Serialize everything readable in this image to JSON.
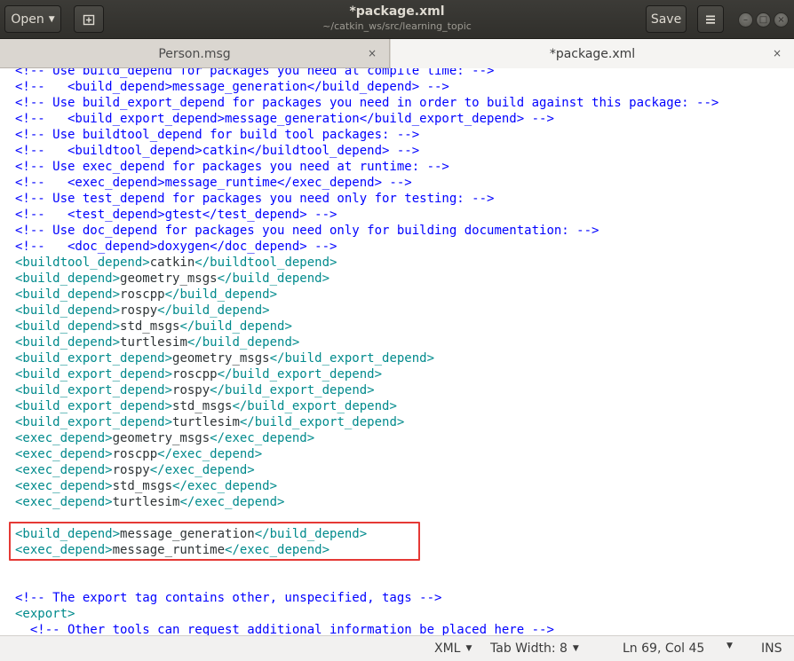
{
  "header": {
    "open_label": "Open",
    "title": "*package.xml",
    "subtitle": "~/catkin_ws/src/learning_topic",
    "save_label": "Save"
  },
  "tabs": [
    {
      "label": "Person.msg",
      "close": "×"
    },
    {
      "label": "*package.xml",
      "close": "×"
    }
  ],
  "editor": {
    "lines": [
      [
        {
          "t": "<!-- Use build_depend for packages you need at compile time: -->",
          "c": "comment"
        }
      ],
      [
        {
          "t": "<!--   <build_depend>message_generation</build_depend> -->",
          "c": "comment"
        }
      ],
      [
        {
          "t": "<!-- Use build_export_depend for packages you need in order to build against this package: -->",
          "c": "comment"
        }
      ],
      [
        {
          "t": "<!--   <build_export_depend>message_generation</build_export_depend> -->",
          "c": "comment"
        }
      ],
      [
        {
          "t": "<!-- Use buildtool_depend for build tool packages: -->",
          "c": "comment"
        }
      ],
      [
        {
          "t": "<!--   <buildtool_depend>catkin</buildtool_depend> -->",
          "c": "comment"
        }
      ],
      [
        {
          "t": "<!-- Use exec_depend for packages you need at runtime: -->",
          "c": "comment"
        }
      ],
      [
        {
          "t": "<!--   <exec_depend>message_runtime</exec_depend> -->",
          "c": "comment"
        }
      ],
      [
        {
          "t": "<!-- Use test_depend for packages you need only for testing: -->",
          "c": "comment"
        }
      ],
      [
        {
          "t": "<!--   <test_depend>gtest</test_depend> -->",
          "c": "comment"
        }
      ],
      [
        {
          "t": "<!-- Use doc_depend for packages you need only for building documentation: -->",
          "c": "comment"
        }
      ],
      [
        {
          "t": "<!--   <doc_depend>doxygen</doc_depend> -->",
          "c": "comment"
        }
      ],
      [
        {
          "t": "<buildtool_depend>",
          "c": "tag"
        },
        {
          "t": "catkin",
          "c": "text"
        },
        {
          "t": "</buildtool_depend>",
          "c": "tag"
        }
      ],
      [
        {
          "t": "<build_depend>",
          "c": "tag"
        },
        {
          "t": "geometry_msgs",
          "c": "text"
        },
        {
          "t": "</build_depend>",
          "c": "tag"
        }
      ],
      [
        {
          "t": "<build_depend>",
          "c": "tag"
        },
        {
          "t": "roscpp",
          "c": "text"
        },
        {
          "t": "</build_depend>",
          "c": "tag"
        }
      ],
      [
        {
          "t": "<build_depend>",
          "c": "tag"
        },
        {
          "t": "rospy",
          "c": "text"
        },
        {
          "t": "</build_depend>",
          "c": "tag"
        }
      ],
      [
        {
          "t": "<build_depend>",
          "c": "tag"
        },
        {
          "t": "std_msgs",
          "c": "text"
        },
        {
          "t": "</build_depend>",
          "c": "tag"
        }
      ],
      [
        {
          "t": "<build_depend>",
          "c": "tag"
        },
        {
          "t": "turtlesim",
          "c": "text"
        },
        {
          "t": "</build_depend>",
          "c": "tag"
        }
      ],
      [
        {
          "t": "<build_export_depend>",
          "c": "tag"
        },
        {
          "t": "geometry_msgs",
          "c": "text"
        },
        {
          "t": "</build_export_depend>",
          "c": "tag"
        }
      ],
      [
        {
          "t": "<build_export_depend>",
          "c": "tag"
        },
        {
          "t": "roscpp",
          "c": "text"
        },
        {
          "t": "</build_export_depend>",
          "c": "tag"
        }
      ],
      [
        {
          "t": "<build_export_depend>",
          "c": "tag"
        },
        {
          "t": "rospy",
          "c": "text"
        },
        {
          "t": "</build_export_depend>",
          "c": "tag"
        }
      ],
      [
        {
          "t": "<build_export_depend>",
          "c": "tag"
        },
        {
          "t": "std_msgs",
          "c": "text"
        },
        {
          "t": "</build_export_depend>",
          "c": "tag"
        }
      ],
      [
        {
          "t": "<build_export_depend>",
          "c": "tag"
        },
        {
          "t": "turtlesim",
          "c": "text"
        },
        {
          "t": "</build_export_depend>",
          "c": "tag"
        }
      ],
      [
        {
          "t": "<exec_depend>",
          "c": "tag"
        },
        {
          "t": "geometry_msgs",
          "c": "text"
        },
        {
          "t": "</exec_depend>",
          "c": "tag"
        }
      ],
      [
        {
          "t": "<exec_depend>",
          "c": "tag"
        },
        {
          "t": "roscpp",
          "c": "text"
        },
        {
          "t": "</exec_depend>",
          "c": "tag"
        }
      ],
      [
        {
          "t": "<exec_depend>",
          "c": "tag"
        },
        {
          "t": "rospy",
          "c": "text"
        },
        {
          "t": "</exec_depend>",
          "c": "tag"
        }
      ],
      [
        {
          "t": "<exec_depend>",
          "c": "tag"
        },
        {
          "t": "std_msgs",
          "c": "text"
        },
        {
          "t": "</exec_depend>",
          "c": "tag"
        }
      ],
      [
        {
          "t": "<exec_depend>",
          "c": "tag"
        },
        {
          "t": "turtlesim",
          "c": "text"
        },
        {
          "t": "</exec_depend>",
          "c": "tag"
        }
      ],
      [],
      [
        {
          "t": "<build_depend>",
          "c": "tag"
        },
        {
          "t": "message_generation",
          "c": "text"
        },
        {
          "t": "</build_depend>",
          "c": "tag"
        }
      ],
      [
        {
          "t": "<exec_depend>",
          "c": "tag"
        },
        {
          "t": "message_runtime",
          "c": "text"
        },
        {
          "t": "</exec_depend>",
          "c": "tag"
        }
      ],
      [],
      [],
      [
        {
          "t": "<!-- The export tag contains other, unspecified, tags -->",
          "c": "comment"
        }
      ],
      [
        {
          "t": "<export>",
          "c": "tag"
        }
      ],
      [
        {
          "t": "  ",
          "c": "text"
        },
        {
          "t": "<!-- Other tools can request additional information be placed here -->",
          "c": "comment"
        }
      ]
    ]
  },
  "status": {
    "language": "XML",
    "tab_width": "Tab Width: 8",
    "position": "Ln 69, Col 45",
    "mode": "INS"
  },
  "colors": {
    "comment": "#0000ff",
    "tag": "#008a8c",
    "text": "#2e3436",
    "highlight_box": "#e53935"
  }
}
